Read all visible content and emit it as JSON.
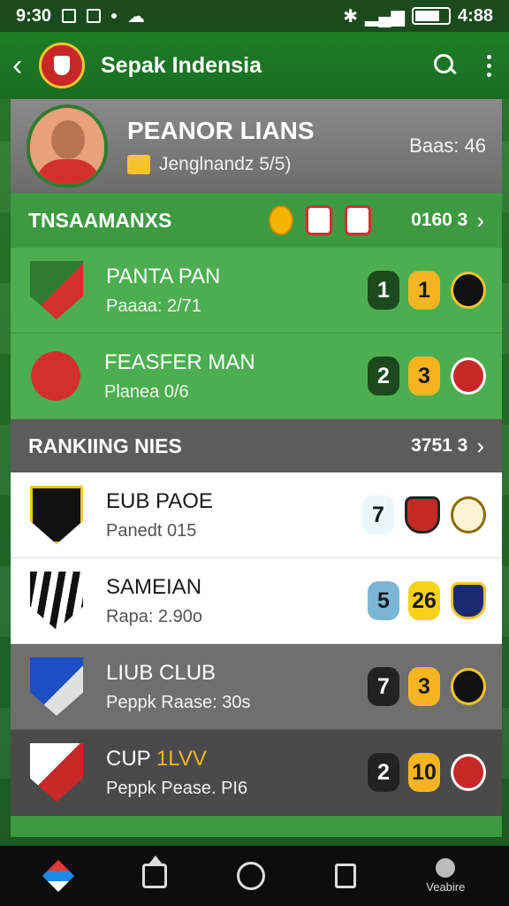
{
  "status_bar": {
    "time": "9:30",
    "right_time": "4:88"
  },
  "app_bar": {
    "title": "Sepak Indensia",
    "icons": [
      "back-arrow-icon",
      "club-logo",
      "search-icon",
      "more-vert-icon"
    ]
  },
  "player": {
    "name": "PEANOR LIANS",
    "subtitle": "Jenglnandz 5/5)",
    "stat": "Baas: 46"
  },
  "section1": {
    "title": "TNSAAMANXS",
    "count": "0160 3",
    "rows": [
      {
        "title": "PANTA PAN",
        "sub": "Paaaa: 2/71",
        "score_a": "1",
        "score_b": "1",
        "crest": "c-green",
        "club": ""
      },
      {
        "title": "FEASFER MAN",
        "sub": "Planea 0/6",
        "score_a": "2",
        "score_b": "3",
        "crest": "c-red round",
        "club": "red"
      }
    ]
  },
  "section2": {
    "title": "RANKIING NIES",
    "count": "3751 3",
    "rows": [
      {
        "title": "EUB PAOE",
        "sub": "Panedt 015",
        "score_a": "7",
        "score_b": "",
        "style": "white"
      },
      {
        "title": "SAMEIAN",
        "sub": "Rapa: 2.90o",
        "score_a": "5",
        "score_b": "26",
        "style": "white"
      },
      {
        "title": "LIUB CLUB",
        "sub": "Peppk Raase: 30s",
        "score_a": "7",
        "score_b": "3",
        "style": "gray"
      },
      {
        "title": "CUP",
        "title_accent": "1LVV",
        "sub": "Peppk Pease. PI6",
        "score_a": "2",
        "score_b": "10",
        "style": "dark"
      }
    ]
  },
  "nav": {
    "last_label": "Veabire"
  },
  "colors": {
    "primary_green": "#1e7d27",
    "accent_gold": "#f6b520"
  }
}
